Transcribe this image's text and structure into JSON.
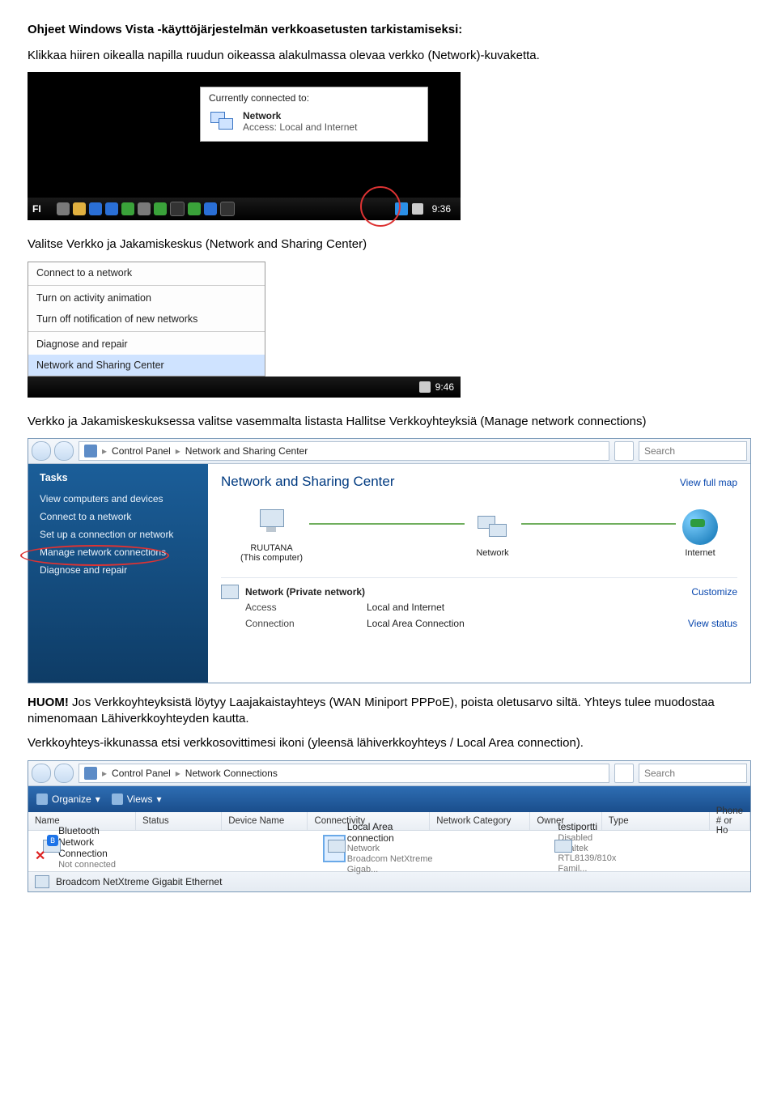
{
  "doc": {
    "heading": "Ohjeet Windows Vista -käyttöjärjestelmän verkkoasetusten tarkistamiseksi:",
    "p1": "Klikkaa hiiren oikealla napilla ruudun oikeassa alakulmassa olevaa verkko (Network)-kuvaketta.",
    "p2": "Valitse Verkko ja Jakamiskeskus (Network and Sharing Center)",
    "p3": "Verkko ja Jakamiskeskuksessa valitse vasemmalta listasta Hallitse Verkkoyhteyksiä (Manage network connections)",
    "huom_label": "HUOM!",
    "huom_rest": " Jos Verkkoyhteyksistä löytyy Laajakaistayhteys (WAN Miniport PPPoE), poista oletusarvo siltä. Yhteys tulee muodostaa nimenomaan Lähiverkkoyhteyden kautta.",
    "p4": "Verkkoyhteys-ikkunassa etsi verkkosovittimesi ikoni (yleensä lähiverkkoyhteys / Local Area connection)."
  },
  "shot1": {
    "connected_to": "Currently connected to:",
    "net_name": "Network",
    "access": "Access:  Local and Internet",
    "lang": "FI",
    "clock": "9:36"
  },
  "shot2": {
    "items": [
      "Connect to a network",
      "Turn on activity animation",
      "Turn off notification of new networks",
      "Diagnose and repair",
      "Network and Sharing Center"
    ],
    "clock": "9:46"
  },
  "shot3": {
    "crumb1": "Control Panel",
    "crumb2": "Network and Sharing Center",
    "search_ph": "Search",
    "tasks_hdr": "Tasks",
    "side_items": [
      "View computers and devices",
      "Connect to a network",
      "Set up a connection or network",
      "Manage network connections",
      "Diagnose and repair"
    ],
    "title": "Network and Sharing Center",
    "view_full_map": "View full map",
    "node_pc_name": "RUUTANA",
    "node_pc_sub": "(This computer)",
    "node_net": "Network",
    "node_internet": "Internet",
    "net_label": "Network (Private network)",
    "customize": "Customize",
    "access_k": "Access",
    "access_v": "Local and Internet",
    "conn_k": "Connection",
    "conn_v": "Local Area Connection",
    "view_status": "View status"
  },
  "shot4": {
    "crumb1": "Control Panel",
    "crumb2": "Network Connections",
    "search_ph": "Search",
    "organize": "Organize",
    "views": "Views",
    "cols": {
      "name": "Name",
      "status": "Status",
      "device": "Device Name",
      "conn": "Connectivity",
      "cat": "Network Category",
      "owner": "Owner",
      "type": "Type",
      "phone": "Phone # or Ho"
    },
    "r1": {
      "name": "Bluetooth Network Connection",
      "status": "Not connected",
      "conn": "Local Area connection",
      "cat": "Network",
      "cat2": "Broadcom NetXtreme Gigab...",
      "owner": "testiportti",
      "own2": "Disabled",
      "type": "Realtek RTL8139/810x Famil..."
    },
    "statusbar": "Broadcom NetXtreme Gigabit Ethernet"
  }
}
